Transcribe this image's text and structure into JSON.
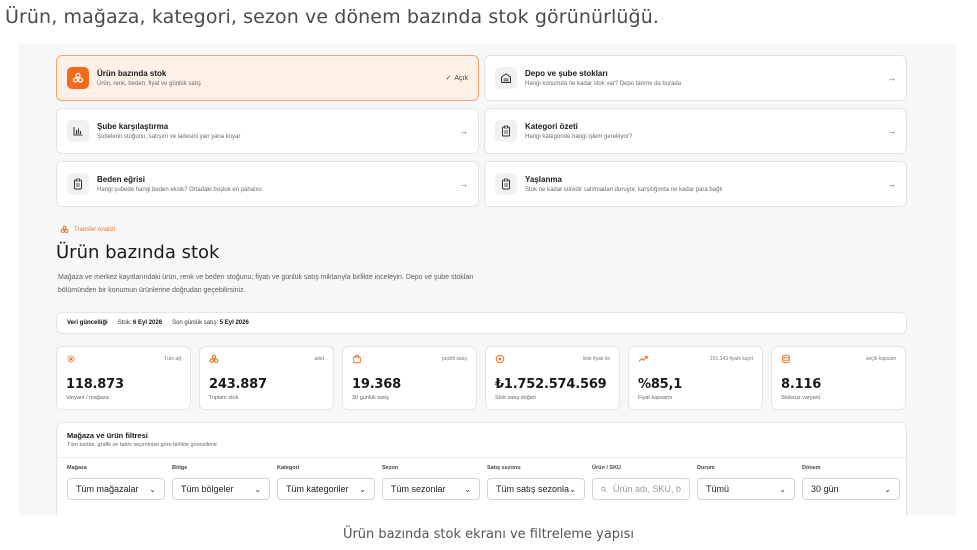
{
  "heading": "Ürün, mağaza, kategori, sezon ve dönem bazında stok görünürlüğü.",
  "caption": "Ürün bazında stok ekranı ve filtreleme yapısı",
  "colors": {
    "accent": "#f26b1d",
    "active_bg": "#fdf0e6",
    "active_border": "#f4a36c"
  },
  "nav": [
    {
      "title": "Ürün bazında stok",
      "desc": "Ürün, renk, beden; fiyat ve günlük satış",
      "status": "Açık",
      "icon": "stack-icon",
      "active": true
    },
    {
      "title": "Depo ve şube stokları",
      "desc": "Hangi konumda ne kadar stok var? Depo tanımı da burada",
      "icon": "warehouse-icon"
    },
    {
      "title": "Şube karşılaştırma",
      "desc": "Şubelerin stoğunu, satışını ve iadesini yan yana koyar",
      "icon": "bar-chart-icon"
    },
    {
      "title": "Kategori özeti",
      "desc": "Hangi kategoride hangi işlem gerekiyor?",
      "icon": "clipboard-icon"
    },
    {
      "title": "Beden eğrisi",
      "desc": "Hangi şubede hangi beden eksik? Ortadaki boşluk en pahalısı",
      "icon": "clipboard-icon"
    },
    {
      "title": "Yaşlanma",
      "desc": "Stok ne kadar süredir satılmadan duruyor, karşılığında ne kadar para bağlı",
      "icon": "clipboard-icon"
    }
  ],
  "section": {
    "tag": "Transfer Analizi",
    "title": "Ürün bazında stok",
    "desc": "Mağaza ve merkez kayıtlarındaki ürün, renk ve beden stoğunu; fiyatı ve günlük satış miktarıyla birlikte inceleyin. Depo ve şube stokları bölümünden bir konumun ürünlerine doğrudan geçebilirsiniz."
  },
  "update": {
    "label": "Veri güncelliği",
    "stock_prefix": "Stok:",
    "stock_date": "6 Eyl 2026",
    "sales_prefix": "Son günlük satış:",
    "sales_date": "5 Eyl 2026"
  },
  "stats": [
    {
      "note": "Tüm ağ",
      "value": "118.873",
      "label": "Varyant / mağaza",
      "icon": "network-icon"
    },
    {
      "note": "adet",
      "value": "243.887",
      "label": "Toplam stok",
      "icon": "stack-icon"
    },
    {
      "note": "pozitif satış",
      "value": "19.368",
      "label": "30 günlük satış",
      "icon": "bag-icon"
    },
    {
      "note": "liste fiyatı ile",
      "value": "₺1.752.574.569",
      "label": "Stok satış değeri",
      "icon": "coin-icon"
    },
    {
      "note": "101.143 fiyatlı kayıt",
      "value": "%85,1",
      "label": "Fiyat kapsamı",
      "icon": "trend-icon"
    },
    {
      "note": "seçili kapsam",
      "value": "8.116",
      "label": "Stoksuz varyant",
      "icon": "database-icon"
    }
  ],
  "filter": {
    "title": "Mağaza ve ürün filtresi",
    "sub": "Tüm kartlar, grafik ve tablo seçiminize göre birlikte güncellenir.",
    "fields": [
      {
        "label": "Mağaza",
        "value": "Tüm mağazalar"
      },
      {
        "label": "Bölge",
        "value": "Tüm bölgeler"
      },
      {
        "label": "Kategori",
        "value": "Tüm kategoriler"
      },
      {
        "label": "Sezon",
        "value": "Tüm sezonlar"
      },
      {
        "label": "Satış sezonu",
        "value": "Tüm satış sezonla"
      },
      {
        "label": "Ürün / SKU",
        "placeholder": "Ürün adı, SKU, b",
        "search": true
      },
      {
        "label": "Durum",
        "value": "Tümü"
      },
      {
        "label": "Dönem",
        "value": "30 gün"
      }
    ]
  }
}
